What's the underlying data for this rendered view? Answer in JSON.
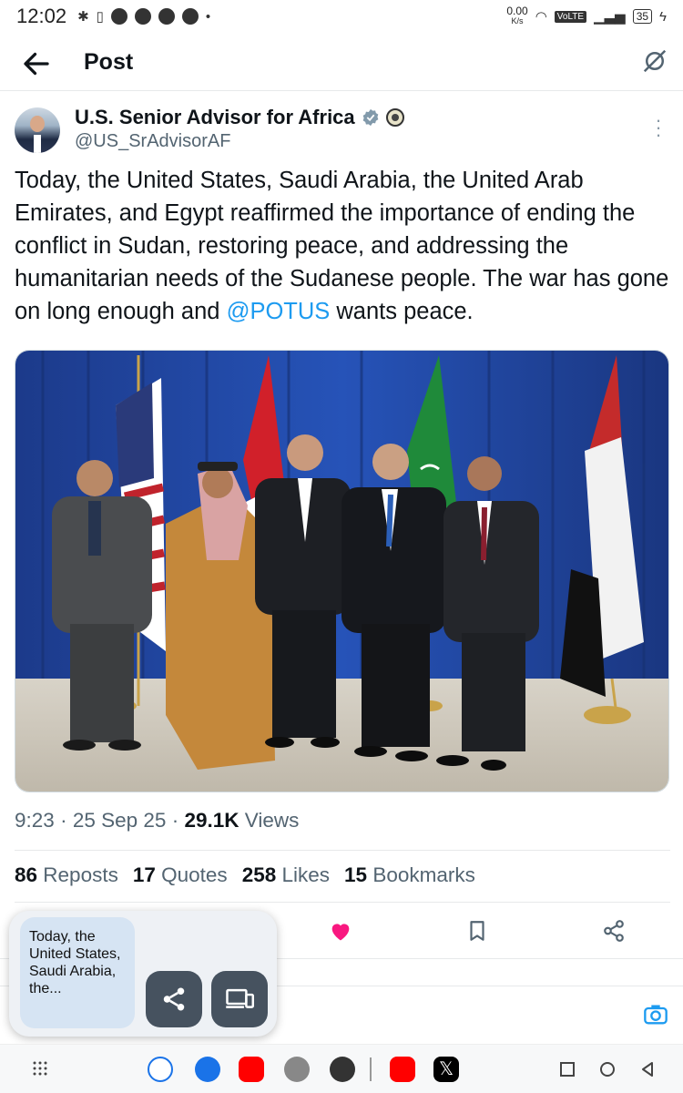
{
  "status": {
    "time": "12:02",
    "net_speed": "0.00",
    "net_unit": "K/s",
    "volte": "VoLTE",
    "battery": "35"
  },
  "header": {
    "title": "Post"
  },
  "author": {
    "name": "U.S. Senior Advisor for Africa",
    "handle": "@US_SrAdvisorAF"
  },
  "tweet": {
    "text_before": "Today, the United States, Saudi Arabia, the United Arab Emirates, and Egypt reaffirmed the importance of ending the conflict in Sudan, restoring peace, and addressing the humanitarian needs of the Sudanese people. The war has gone on long enough and ",
    "mention": "@POTUS",
    "text_after": " wants peace."
  },
  "meta": {
    "time": "9:23",
    "dot": "·",
    "date": "25 Sep 25",
    "views_count": "29.1K",
    "views_label": "Views"
  },
  "stats": [
    {
      "count": "86",
      "label": "Reposts"
    },
    {
      "count": "17",
      "label": "Quotes"
    },
    {
      "count": "258",
      "label": "Likes"
    },
    {
      "count": "15",
      "label": "Bookmarks"
    }
  ],
  "share_sheet": {
    "preview_text": "Today, the United States, Saudi Arabia, the..."
  },
  "colors": {
    "accent": "#1d9bf0",
    "like": "#f91880",
    "repost": "#00ba7c"
  }
}
